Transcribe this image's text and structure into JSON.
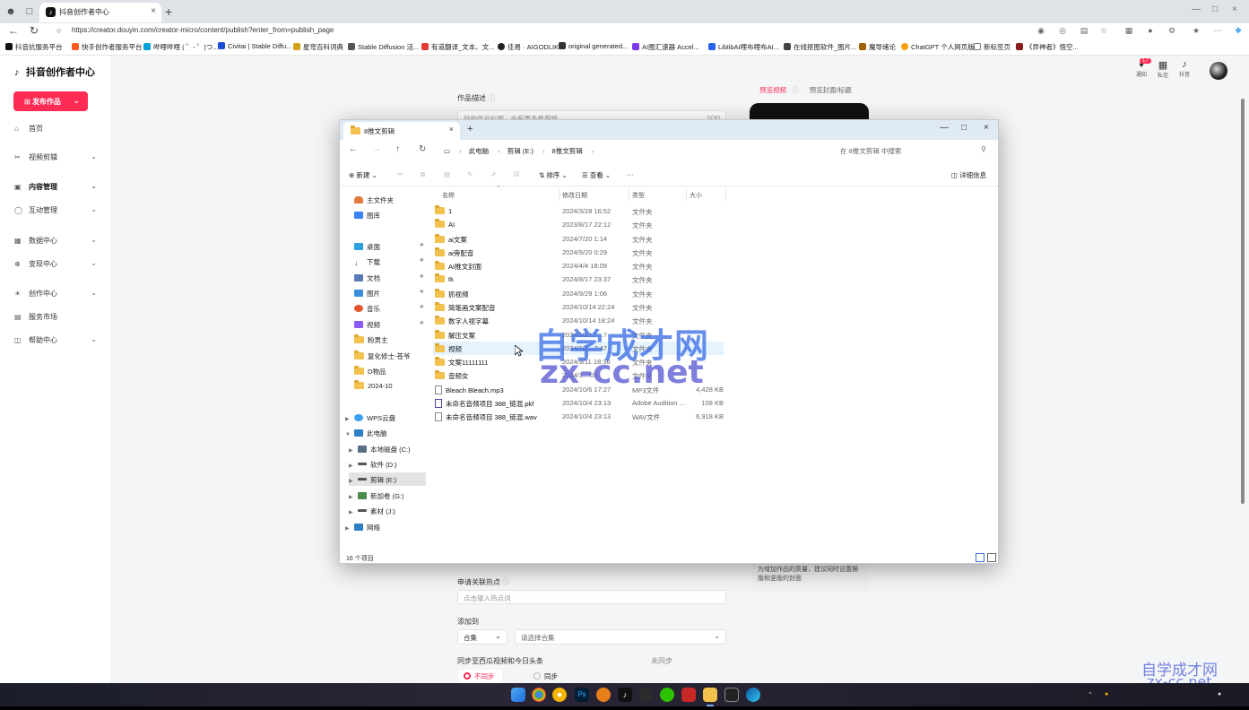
{
  "browser": {
    "tab_title": "抖音创作者中心",
    "url": "https://creator.douyin.com/creator-micro/content/publish?enter_from=publish_page",
    "bookmarks": [
      "抖音抗服务平台",
      "快手创作者服务平台",
      "哔哩哔哩 ( ゜- ゜)つ...",
      "Civitai | Stable Diffu...",
      "星穹百科词典",
      "Stable Diffusion 活...",
      "有道翻译_文本、文...",
      "佳易 · AIGODLIKE",
      "original generated...",
      "AI图汇速器 Accel...",
      "LiblibAI哩布哩布AI...",
      "在线抠图软件_图片...",
      "魔导绪论",
      "ChatGPT 个人网页版",
      "新标签页",
      "《异神者》悟空..."
    ]
  },
  "sidebar": {
    "logo": "抖音创作者中心",
    "publish_button": "发布作品",
    "items": [
      {
        "label": "首页",
        "icon": "home-icon"
      },
      {
        "label": "视频剪辑",
        "icon": "scissors-icon"
      },
      {
        "label": "内容管理",
        "icon": "content-icon"
      },
      {
        "label": "互动管理",
        "icon": "comment-icon"
      },
      {
        "label": "数据中心",
        "icon": "chart-icon"
      },
      {
        "label": "变现中心",
        "icon": "money-icon"
      },
      {
        "label": "创作中心",
        "icon": "bulb-icon"
      },
      {
        "label": "服务市场",
        "icon": "store-icon"
      },
      {
        "label": "帮助中心",
        "icon": "book-icon"
      }
    ]
  },
  "header": {
    "notification_count": "17",
    "links": [
      "通知",
      "私信",
      "抖音"
    ]
  },
  "form": {
    "description_label": "作品描述",
    "description_counter": "0/30",
    "description_placeholder": "好的作品标题，会有更多推荐哦",
    "preview_tab_active": "预览视频",
    "preview_tab_inactive": "预览封面/标题",
    "cover_tip": "为增加作品的质量，建议同时设置横版和竖版的封面",
    "hotspot_label": "申请关联热点",
    "hotspot_placeholder": "点击输入热点词",
    "collection_label": "添加到",
    "collection_type": "合集",
    "collection_placeholder": "请选择合集",
    "sync_label": "同步至西瓜视频和今日头条",
    "sync_status": "未同步",
    "sync_options": [
      "不同步",
      "同步"
    ]
  },
  "explorer": {
    "tab_title": "8推文剪辑",
    "path": [
      "此电脑",
      "剪辑 (E:)",
      "8推文剪辑"
    ],
    "search_placeholder": "在 8推文剪辑 中搜索",
    "commands": {
      "new": "新建",
      "sort": "排序",
      "view": "查看",
      "more": "···",
      "details": "详细信息"
    },
    "nav_pane": [
      {
        "label": "主文件夹",
        "kind": "home"
      },
      {
        "label": "图库",
        "kind": "gallery"
      },
      {
        "label": "桌面",
        "kind": "desktop",
        "pinned": true
      },
      {
        "label": "下载",
        "kind": "download",
        "pinned": true
      },
      {
        "label": "文档",
        "kind": "docs",
        "pinned": true
      },
      {
        "label": "图片",
        "kind": "pictures",
        "pinned": true
      },
      {
        "label": "音乐",
        "kind": "music",
        "pinned": true
      },
      {
        "label": "视频",
        "kind": "videos",
        "pinned": true
      },
      {
        "label": "粉男主",
        "kind": "folder"
      },
      {
        "label": "复化修士-苍爷",
        "kind": "folder"
      },
      {
        "label": "D物品",
        "kind": "folder"
      },
      {
        "label": "2024-10",
        "kind": "folder"
      },
      {
        "label": "WPS云盘",
        "kind": "cloud"
      },
      {
        "label": "此电脑",
        "kind": "pc"
      },
      {
        "label": "本地磁盘 (C:)",
        "kind": "drive"
      },
      {
        "label": "软件 (D:)",
        "kind": "drive"
      },
      {
        "label": "剪辑 (E:)",
        "kind": "drive",
        "selected": true
      },
      {
        "label": "新加卷 (G:)",
        "kind": "drive"
      },
      {
        "label": "素材 (J:)",
        "kind": "drive"
      },
      {
        "label": "网络",
        "kind": "network"
      }
    ],
    "columns": [
      "名称",
      "修改日期",
      "类型",
      "大小"
    ],
    "files": [
      {
        "name": "1",
        "date": "2024/3/28 16:52",
        "type": "文件夹",
        "size": "",
        "kind": "folder"
      },
      {
        "name": "AI",
        "date": "2023/8/17 22:12",
        "type": "文件夹",
        "size": "",
        "kind": "folder"
      },
      {
        "name": "ai文案",
        "date": "2024/7/20 1:14",
        "type": "文件夹",
        "size": "",
        "kind": "folder"
      },
      {
        "name": "ai旁配音",
        "date": "2024/9/20 0:29",
        "type": "文件夹",
        "size": "",
        "kind": "folder"
      },
      {
        "name": "AI推文封面",
        "date": "2024/4/4 18:09",
        "type": "文件夹",
        "size": "",
        "kind": "folder"
      },
      {
        "name": "tk",
        "date": "2024/8/17 23:37",
        "type": "文件夹",
        "size": "",
        "kind": "folder"
      },
      {
        "name": "抓视频",
        "date": "2024/9/29 1:06",
        "type": "文件夹",
        "size": "",
        "kind": "folder"
      },
      {
        "name": "简笔画文案配音",
        "date": "2024/10/14 22:24",
        "type": "文件夹",
        "size": "",
        "kind": "folder"
      },
      {
        "name": "数字人视字幕",
        "date": "2024/10/14 18:24",
        "type": "文件夹",
        "size": "",
        "kind": "folder"
      },
      {
        "name": "解压文案",
        "date": "2024/10/12 ...7",
        "type": "文件夹",
        "size": "",
        "kind": "folder"
      },
      {
        "name": "视频",
        "date": "2024/10/...7:47",
        "type": "文件夹",
        "size": "",
        "kind": "folder"
      },
      {
        "name": "文案11111111",
        "date": "2024/9/11 18:36",
        "type": "文件夹",
        "size": "",
        "kind": "folder"
      },
      {
        "name": "音频女",
        "date": "2024/1...:05",
        "type": "文件夹",
        "size": "",
        "kind": "folder"
      },
      {
        "name": "Bleach Bleach.mp3",
        "date": "2024/10/6 17:27",
        "type": "MP3文件",
        "size": "4,428 KB",
        "kind": "file"
      },
      {
        "name": "未命名音频项目 388_链混.pkf",
        "date": "2024/10/4 23:13",
        "type": "Adobe Audition ...",
        "size": "108 KB",
        "kind": "file"
      },
      {
        "name": "未命名音频项目 388_链混.wav",
        "date": "2024/10/4 23:13",
        "type": "WAV文件",
        "size": "6,918 KB",
        "kind": "file"
      }
    ],
    "status": "16 个项目"
  },
  "watermark": {
    "cn": "自学成才网",
    "en": "zx-cc.net"
  },
  "colors": {
    "brand": "#fe2c55",
    "folder": "#f2c14e",
    "selection": "#e5f3ff"
  }
}
